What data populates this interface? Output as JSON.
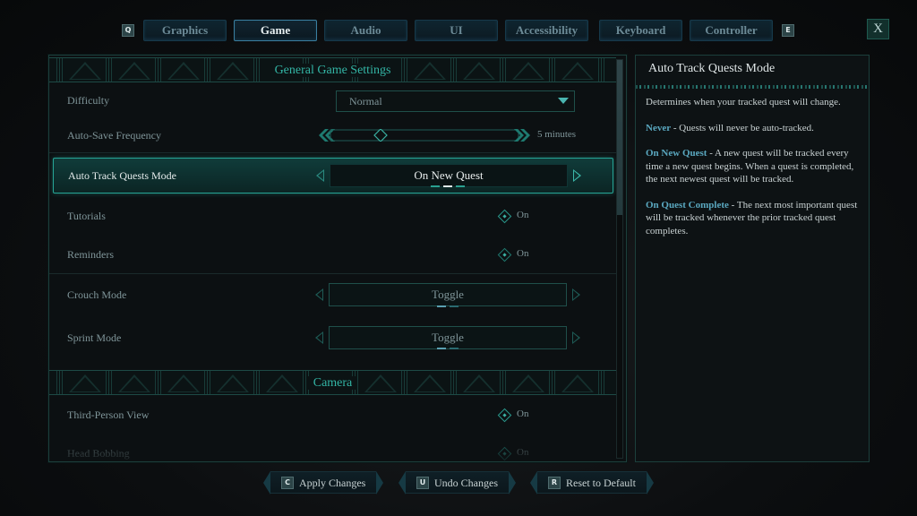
{
  "tabs": {
    "prev_key": "Q",
    "next_key": "E",
    "items": [
      {
        "label": "Graphics",
        "active": false
      },
      {
        "label": "Game",
        "active": true
      },
      {
        "label": "Audio",
        "active": false
      },
      {
        "label": "UI",
        "active": false
      },
      {
        "label": "Accessibility",
        "active": false
      },
      {
        "label": "Keyboard",
        "active": false
      },
      {
        "label": "Controller",
        "active": false
      }
    ],
    "close_label": "X"
  },
  "sections": {
    "general": {
      "title": "General Game Settings"
    },
    "camera": {
      "title": "Camera"
    }
  },
  "settings": {
    "difficulty": {
      "label": "Difficulty",
      "value": "Normal"
    },
    "autosave": {
      "label": "Auto-Save Frequency",
      "value": "5 minutes",
      "slider_fraction": 0.25
    },
    "auto_track": {
      "label": "Auto Track Quests Mode",
      "value": "On New Quest",
      "option_index": 1,
      "option_count": 3
    },
    "tutorials": {
      "label": "Tutorials",
      "value": "On"
    },
    "reminders": {
      "label": "Reminders",
      "value": "On"
    },
    "crouch": {
      "label": "Crouch Mode",
      "value": "Toggle",
      "option_index": 0,
      "option_count": 2
    },
    "sprint": {
      "label": "Sprint Mode",
      "value": "Toggle",
      "option_index": 0,
      "option_count": 2
    },
    "third_person": {
      "label": "Third-Person View",
      "value": "On"
    },
    "head_bobbing": {
      "label": "Head Bobbing",
      "value": "On"
    }
  },
  "info": {
    "title": "Auto Track Quests Mode",
    "intro": "Determines when your tracked quest will change.",
    "options": [
      {
        "name": "Never",
        "desc": " - Quests will never be auto-tracked."
      },
      {
        "name": "On New Quest",
        "desc": " - A new quest will be tracked every time a new quest begins. When a quest is completed, the next newest quest will be tracked."
      },
      {
        "name": "On Quest Complete",
        "desc": " - The next most important quest will be tracked whenever the prior tracked quest completes."
      }
    ]
  },
  "footer": {
    "apply": {
      "key": "C",
      "label": "Apply Changes"
    },
    "undo": {
      "key": "U",
      "label": "Undo Changes"
    },
    "reset": {
      "key": "R",
      "label": "Reset to Default"
    }
  },
  "scroll": {
    "position_fraction": 0.0,
    "visible_fraction": 0.39
  }
}
